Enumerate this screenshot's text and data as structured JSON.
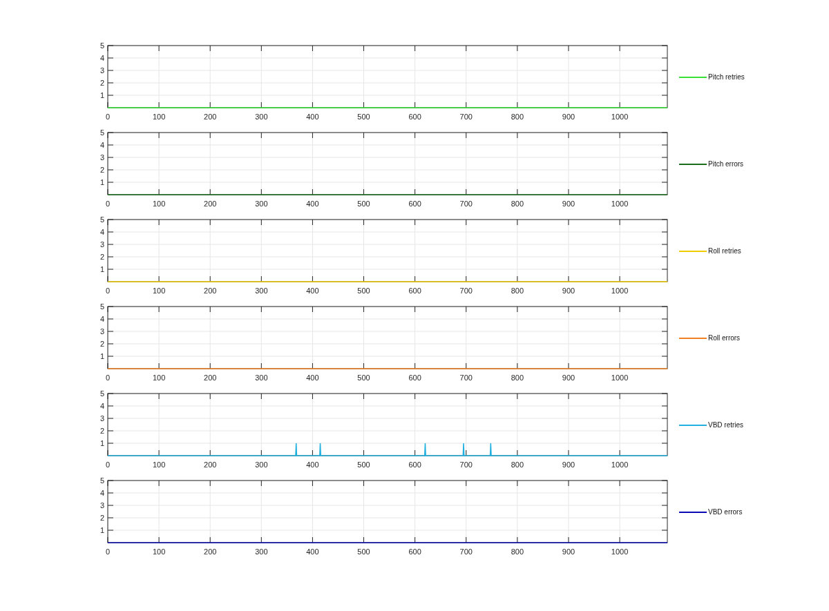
{
  "subplots": [
    {
      "chart_data": {
        "type": "line",
        "grid": true,
        "x": [
          0,
          1093
        ],
        "xlim": [
          0,
          1093
        ],
        "ylim": [
          0,
          5
        ],
        "xticks": [
          0,
          100,
          200,
          300,
          400,
          500,
          600,
          700,
          800,
          900,
          1000
        ],
        "yticks": [
          1,
          2,
          3,
          4,
          5
        ],
        "series": [
          {
            "name": "Pitch retries",
            "color": "#33e033",
            "values": [
              0,
              0
            ]
          }
        ]
      }
    },
    {
      "chart_data": {
        "type": "line",
        "grid": true,
        "x": [
          0,
          1093
        ],
        "xlim": [
          0,
          1093
        ],
        "ylim": [
          0,
          5
        ],
        "xticks": [
          0,
          100,
          200,
          300,
          400,
          500,
          600,
          700,
          800,
          900,
          1000
        ],
        "yticks": [
          1,
          2,
          3,
          4,
          5
        ],
        "series": [
          {
            "name": "Pitch errors",
            "color": "#1a6e1a",
            "values": [
              0,
              0
            ]
          }
        ]
      }
    },
    {
      "chart_data": {
        "type": "line",
        "grid": true,
        "x": [
          0,
          1093
        ],
        "xlim": [
          0,
          1093
        ],
        "ylim": [
          0,
          5
        ],
        "xticks": [
          0,
          100,
          200,
          300,
          400,
          500,
          600,
          700,
          800,
          900,
          1000
        ],
        "yticks": [
          1,
          2,
          3,
          4,
          5
        ],
        "series": [
          {
            "name": "Roll retries",
            "color": "#f2cc00",
            "values": [
              0,
              0
            ]
          }
        ]
      }
    },
    {
      "chart_data": {
        "type": "line",
        "grid": true,
        "x": [
          0,
          1093
        ],
        "xlim": [
          0,
          1093
        ],
        "ylim": [
          0,
          5
        ],
        "xticks": [
          0,
          100,
          200,
          300,
          400,
          500,
          600,
          700,
          800,
          900,
          1000
        ],
        "yticks": [
          1,
          2,
          3,
          4,
          5
        ],
        "series": [
          {
            "name": "Roll errors",
            "color": "#f08020",
            "values": [
              0,
              0
            ]
          }
        ]
      }
    },
    {
      "chart_data": {
        "type": "line",
        "grid": true,
        "x": [
          0,
          367,
          368,
          369,
          414,
          415,
          416,
          619,
          620,
          621,
          694,
          695,
          696,
          747,
          748,
          749,
          1093
        ],
        "xlim": [
          0,
          1093
        ],
        "ylim": [
          0,
          5
        ],
        "xticks": [
          0,
          100,
          200,
          300,
          400,
          500,
          600,
          700,
          800,
          900,
          1000
        ],
        "yticks": [
          1,
          2,
          3,
          4,
          5
        ],
        "series": [
          {
            "name": "VBD retries",
            "color": "#20b0e0",
            "values": [
              0,
              0,
              1,
              0,
              0,
              1,
              0,
              0,
              1,
              0,
              0,
              1,
              0,
              0,
              1,
              0,
              0
            ]
          }
        ]
      }
    },
    {
      "chart_data": {
        "type": "line",
        "grid": true,
        "x": [
          0,
          1093
        ],
        "xlim": [
          0,
          1093
        ],
        "ylim": [
          0,
          5
        ],
        "xticks": [
          0,
          100,
          200,
          300,
          400,
          500,
          600,
          700,
          800,
          900,
          1000
        ],
        "yticks": [
          1,
          2,
          3,
          4,
          5
        ],
        "series": [
          {
            "name": "VBD errors",
            "color": "#0a0ab0",
            "values": [
              0,
              0
            ]
          }
        ]
      }
    }
  ]
}
